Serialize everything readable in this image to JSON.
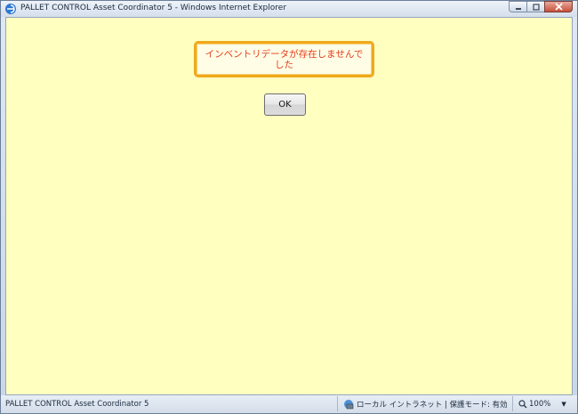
{
  "window": {
    "title": "PALLET CONTROL Asset Coordinator 5 - Windows Internet Explorer",
    "controls": {
      "minimize": "minimize-icon",
      "maximize": "maximize-icon",
      "close": "close-icon"
    }
  },
  "content": {
    "message": "インベントリデータが存在しませんでした",
    "ok_label": "OK",
    "background": "#ffffc0"
  },
  "statusbar": {
    "text": "PALLET CONTROL Asset Coordinator 5",
    "zone": "ローカル イントラネット | 保護モード: 有効",
    "zoom": "100%"
  },
  "colors": {
    "message_text": "#e53d1a",
    "message_border": "#efa91c"
  }
}
